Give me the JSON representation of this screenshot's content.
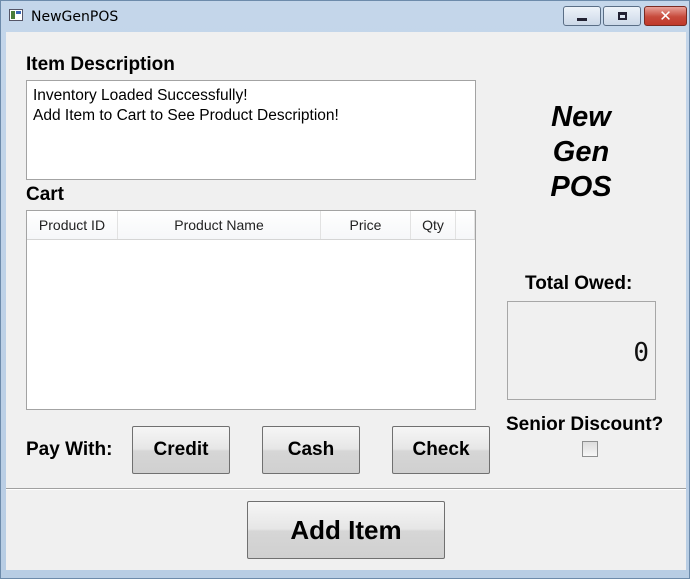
{
  "window": {
    "title": "NewGenPOS",
    "close_glyph": "✕",
    "icons": {
      "app": "app-icon",
      "minimize": "minimize-icon",
      "maximize": "maximize-icon",
      "close": "close-icon"
    }
  },
  "item_description": {
    "label": "Item Description",
    "lines": [
      "Inventory Loaded Successfully!",
      "Add Item to Cart to See Product Description!"
    ]
  },
  "cart": {
    "label": "Cart",
    "columns": [
      "Product ID",
      "Product Name",
      "Price",
      "Qty"
    ],
    "rows": []
  },
  "brand": {
    "lines": [
      "New",
      "Gen",
      "POS"
    ]
  },
  "total": {
    "label": "Total Owed:",
    "value": "0"
  },
  "senior_discount": {
    "label": "Senior Discount?",
    "checked": false
  },
  "payment": {
    "label": "Pay With:",
    "credit": "Credit",
    "cash": "Cash",
    "check": "Check"
  },
  "add_item": {
    "label": "Add Item"
  }
}
